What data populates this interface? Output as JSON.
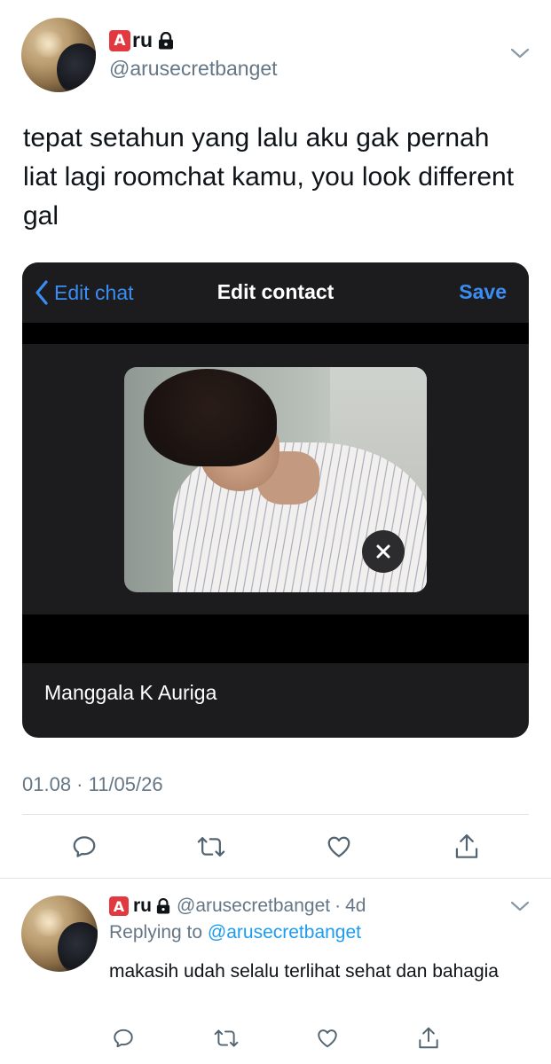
{
  "tweet": {
    "author_name": "ru",
    "author_badge": "A",
    "author_handle": "@arusecretbanget",
    "text": "tepat setahun yang lalu aku gak pernah liat lagi roomchat kamu, you look different gal",
    "timestamp": "01.08 · 11/05/26"
  },
  "embedded_screenshot": {
    "back_label": "Edit chat",
    "title": "Edit contact",
    "save_label": "Save",
    "contact_name": "Manggala K Auriga"
  },
  "reply": {
    "author_name": "ru",
    "author_badge": "A",
    "author_handle": "@arusecretbanget",
    "age": "4d",
    "replying_prefix": "Replying to",
    "replying_to": "@arusecretbanget",
    "text": "makasih udah selalu terlihat sehat dan bahagia"
  },
  "colors": {
    "badge": "#e2383f",
    "link": "#1d9bf0",
    "ios_blue": "#3a8df3",
    "muted": "#657786"
  },
  "icons": [
    "chevron-down-icon",
    "lock-icon",
    "back-chevron-icon",
    "close-icon",
    "reply-icon",
    "retweet-icon",
    "like-icon",
    "share-icon"
  ]
}
